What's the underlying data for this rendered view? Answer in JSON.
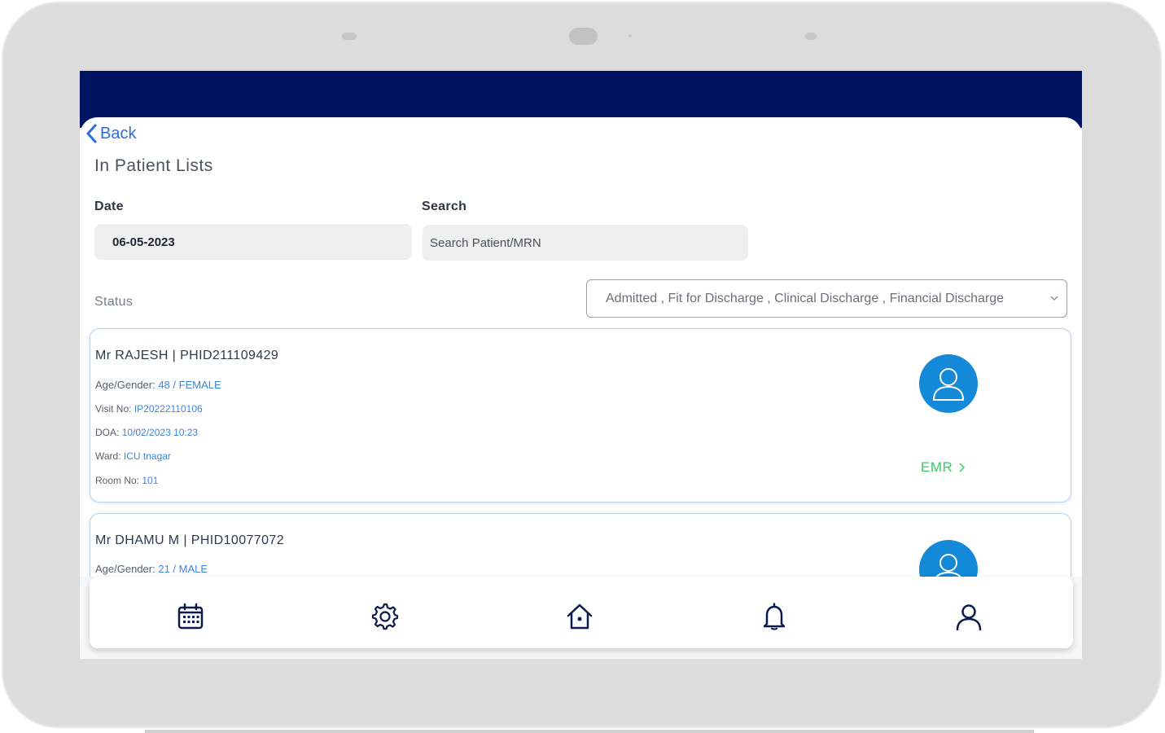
{
  "app": {
    "back_label": "Back",
    "page_title": "In Patient Lists"
  },
  "filters": {
    "date_label": "Date",
    "date_value": "06-05-2023",
    "search_label": "Search",
    "search_placeholder": "Search Patient/MRN",
    "status_label": "Status",
    "status_selected": "Admitted , Fit for Discharge , Clinical Discharge , Financial Discharge"
  },
  "patients": [
    {
      "name": "Mr RAJESH | PHID211109429",
      "age_gender_label": "Age/Gender:",
      "age_gender_value": "48 / FEMALE",
      "visit_label": "Visit No:",
      "visit_value": "IP20222110106",
      "doa_label": "DOA:",
      "doa_value": "10/02/2023 10:23",
      "ward_label": "Ward:",
      "ward_value": "ICU tnagar",
      "room_label": "Room No:",
      "room_value": "101",
      "emr_label": "EMR"
    },
    {
      "name": "Mr DHAMU M | PHID10077072",
      "age_gender_label": "Age/Gender:",
      "age_gender_value": "21 / MALE"
    }
  ],
  "bottom_nav": [
    {
      "icon": "calendar-icon"
    },
    {
      "icon": "gear-icon"
    },
    {
      "icon": "home-icon"
    },
    {
      "icon": "bell-icon"
    },
    {
      "icon": "user-icon"
    }
  ],
  "colors": {
    "header": "#001360",
    "accent_blue": "#2a6de0",
    "avatar_blue": "#1389d8",
    "emr_green": "#33cc66",
    "card_border": "#b9d3ee"
  }
}
